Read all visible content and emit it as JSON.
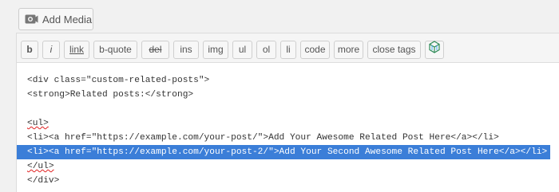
{
  "media": {
    "add_label": "Add Media",
    "icon": "media-camera-icon"
  },
  "toolbar": {
    "buttons": [
      {
        "label": "b"
      },
      {
        "label": "i"
      },
      {
        "label": "link"
      },
      {
        "label": "b-quote"
      },
      {
        "label": "del"
      },
      {
        "label": "ins"
      },
      {
        "label": "img"
      },
      {
        "label": "ul"
      },
      {
        "label": "ol"
      },
      {
        "label": "li"
      },
      {
        "label": "code"
      },
      {
        "label": "more"
      },
      {
        "label": "close tags"
      }
    ],
    "plugin_icon": "cube-icon"
  },
  "editor": {
    "lines": [
      "<div class=\"custom-related-posts\">",
      "<strong>Related posts:</strong>",
      "",
      "<ul>",
      "<li><a href=\"https://example.com/your-post/\">Add Your Awesome Related Post Here</a></li>",
      "<li><a href=\"https://example.com/your-post-2/\">Add Your Second Awesome Related Post Here</a></li>",
      "</ul>",
      "</div>"
    ],
    "selected_line_index": 5
  },
  "colors": {
    "selection": "#3b7ed8",
    "spellcheck": "#e02020"
  }
}
